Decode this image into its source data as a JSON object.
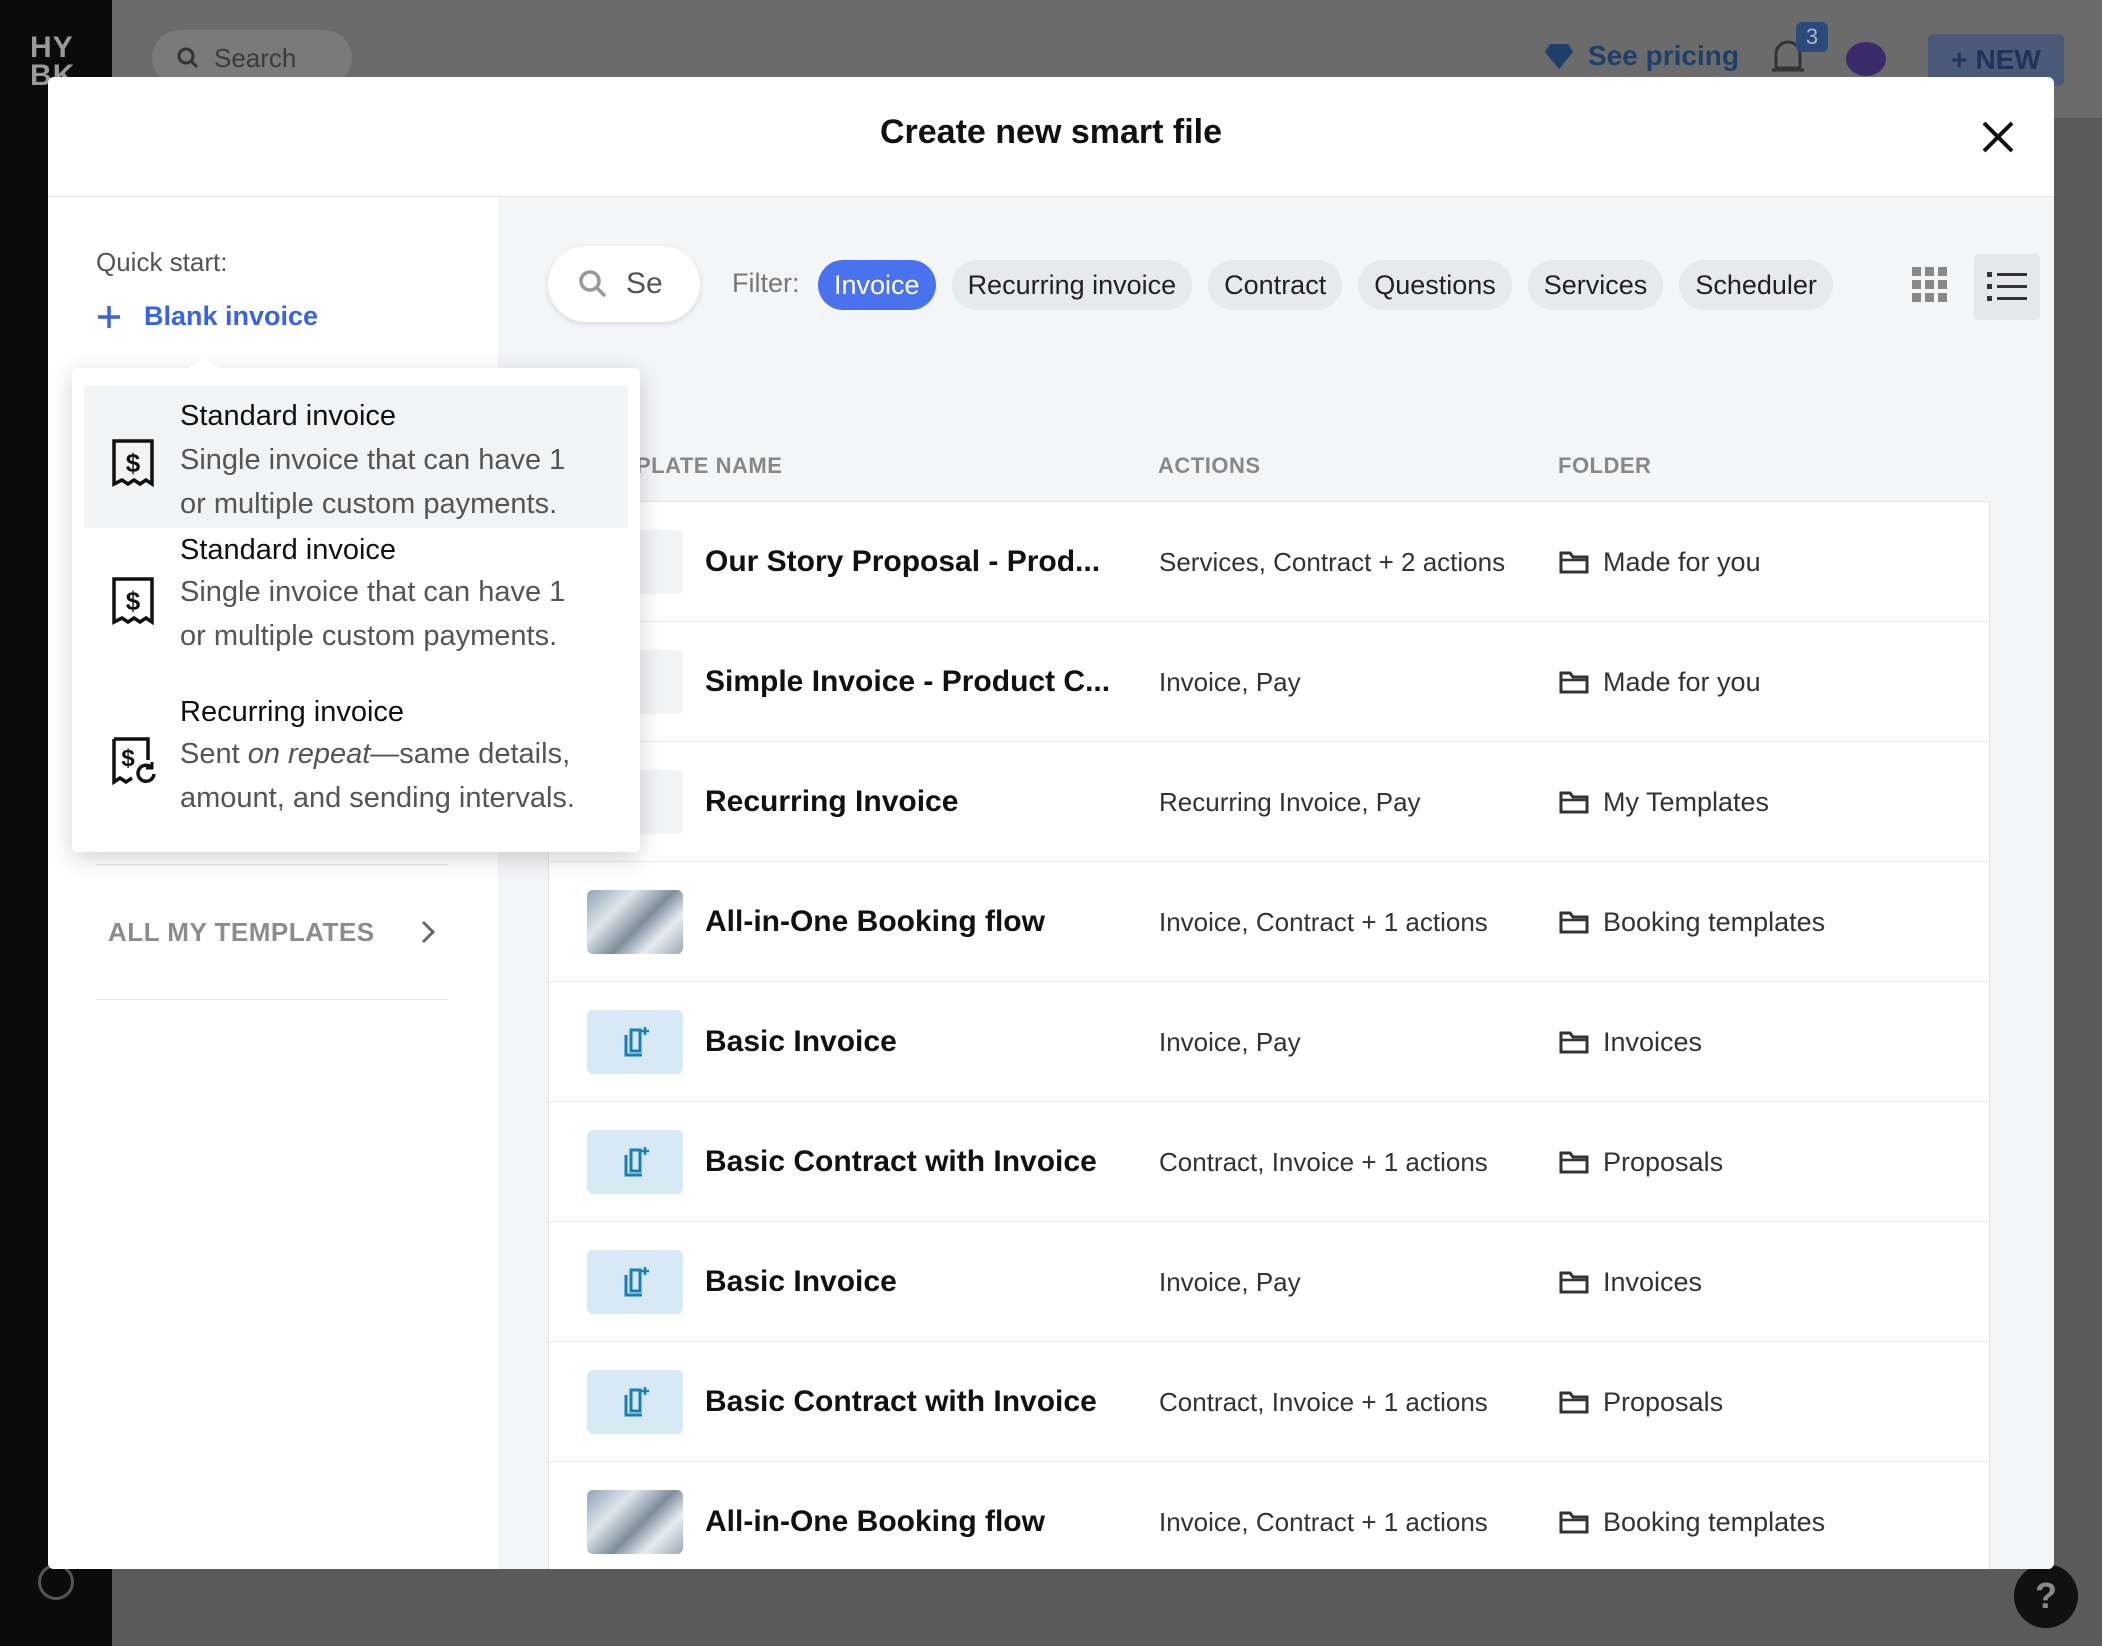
{
  "app": {
    "logo": "HY BK",
    "search_label": "Search",
    "pricing_label": "See pricing",
    "notification_count": "3",
    "new_button": "NEW",
    "help_label": "?"
  },
  "modal": {
    "title": "Create new smart file"
  },
  "quick_start": {
    "label": "Quick start:",
    "blank_invoice": "Blank invoice",
    "all_templates": "ALL MY TEMPLATES"
  },
  "dropdown": {
    "items": [
      {
        "title": "Standard invoice",
        "desc_line1": "Single invoice that can have 1",
        "desc_line2": "or multiple custom payments.",
        "icon": "invoice-dollar-icon"
      },
      {
        "title": "Standard invoice",
        "desc_line1": "Single invoice that can have 1",
        "desc_line2": "or multiple custom payments.",
        "icon": "invoice-dollar-icon"
      },
      {
        "title": "Recurring invoice",
        "desc_pre": "Sent ",
        "desc_em": "on repeat",
        "desc_post": "—same details,",
        "desc_line2": "amount, and sending intervals.",
        "icon": "recurring-invoice-icon"
      }
    ]
  },
  "toolbar": {
    "search_placeholder": "Search",
    "search_value": "Se",
    "filter_label": "Filter:",
    "filters": [
      "Invoice",
      "Recurring invoice",
      "Contract",
      "Questions",
      "Services",
      "Scheduler"
    ],
    "active_filter": "Invoice"
  },
  "table": {
    "headers": {
      "name": "TEMPLATE NAME",
      "name_visible": "PLATE NAME",
      "actions": "ACTIONS",
      "folder": "FOLDER"
    },
    "rows": [
      {
        "name": "Our Story Proposal - Prod...",
        "actions": "Services, Contract + 2 actions",
        "folder": "Made for you",
        "thumb": "doc"
      },
      {
        "name": "Simple Invoice - Product C...",
        "actions": "Invoice, Pay",
        "folder": "Made for you",
        "thumb": "doc"
      },
      {
        "name": "Recurring Invoice",
        "actions": "Recurring Invoice, Pay",
        "folder": "My Templates",
        "thumb": "doc"
      },
      {
        "name": "All-in-One Booking flow",
        "actions": "Invoice, Contract + 1 actions",
        "folder": "Booking templates",
        "thumb": "photo"
      },
      {
        "name": "Basic Invoice",
        "actions": "Invoice, Pay",
        "folder": "Invoices",
        "thumb": "template-icon"
      },
      {
        "name": "Basic Contract with Invoice",
        "actions": "Contract, Invoice + 1 actions",
        "folder": "Proposals",
        "thumb": "template-icon"
      },
      {
        "name": "Basic Invoice",
        "actions": "Invoice, Pay",
        "folder": "Invoices",
        "thumb": "template-icon"
      },
      {
        "name": "Basic Contract with Invoice",
        "actions": "Contract, Invoice + 1 actions",
        "folder": "Proposals",
        "thumb": "template-icon"
      },
      {
        "name": "All-in-One Booking flow",
        "actions": "Invoice, Contract + 1 actions",
        "folder": "Booking templates",
        "thumb": "photo"
      }
    ]
  },
  "colors": {
    "accent": "#4a72ec",
    "link": "#3a63e0",
    "template_thumb": "#d7e9f5",
    "template_icon": "#1a7fb8"
  }
}
